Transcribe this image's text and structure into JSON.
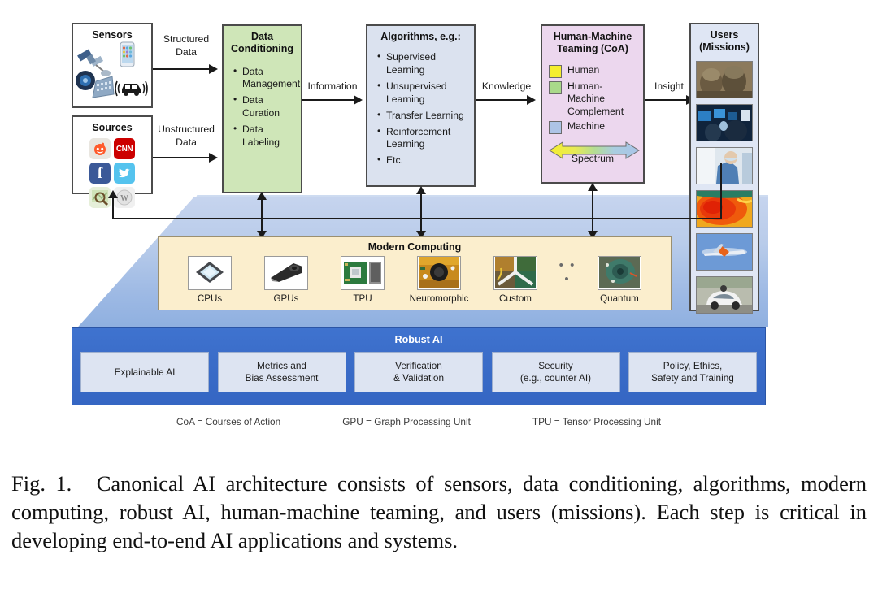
{
  "figure": {
    "sensors": {
      "title": "Sensors",
      "icons": [
        "satellite-icon",
        "smartphone-icon",
        "radar-icon",
        "building-sensor-icon",
        "connected-car-icon"
      ]
    },
    "sources": {
      "title": "Sources",
      "icons": [
        "reddit-icon",
        "cnn-icon",
        "facebook-icon",
        "twitter-icon",
        "google-maps-icon",
        "wikipedia-icon"
      ]
    },
    "arrows": {
      "structured": "Structured\nData",
      "structured_l1": "Structured",
      "structured_l2": "Data",
      "unstructured_l1": "Unstructured",
      "unstructured_l2": "Data",
      "information": "Information",
      "knowledge": "Knowledge",
      "insight": "Insight"
    },
    "data_conditioning": {
      "title_l1": "Data",
      "title_l2": "Conditioning",
      "items": [
        "Data Management",
        "Data Curation",
        "Data Labeling"
      ]
    },
    "algorithms": {
      "title": "Algorithms, e.g.:",
      "items": [
        "Supervised Learning",
        "Unsupervised Learning",
        "Transfer Learning",
        "Reinforcement Learning",
        "Etc."
      ]
    },
    "hmt": {
      "title_l1": "Human-Machine",
      "title_l2": "Teaming (CoA)",
      "legend": [
        {
          "label": "Human",
          "color": "#f5ee2e"
        },
        {
          "label": "Human-Machine Complement",
          "color": "#a9d98a"
        },
        {
          "label": "Machine",
          "color": "#adc4e6"
        }
      ],
      "spectrum_label": "Spectrum"
    },
    "users": {
      "title_l1": "Users",
      "title_l2": "(Missions)",
      "thumbnails": [
        "soldiers-photo",
        "operations-center-photo",
        "medical-staff-photo",
        "thermal-map-photo",
        "aircraft-photo",
        "autonomous-car-photo"
      ]
    },
    "modern_computing": {
      "title": "Modern Computing",
      "items": [
        {
          "label": "CPUs",
          "icon": "cpu-chip-icon"
        },
        {
          "label": "GPUs",
          "icon": "gpu-card-icon"
        },
        {
          "label": "TPU",
          "icon": "tpu-board-icon"
        },
        {
          "label": "Neuromorphic",
          "icon": "neuromorphic-chip-icon"
        },
        {
          "label": "Custom",
          "icon": "custom-hardware-icon"
        },
        {
          "label": "Quantum",
          "icon": "quantum-processor-icon"
        }
      ],
      "ellipsis": "• • •"
    },
    "robust_ai": {
      "title": "Robust AI",
      "cards": [
        "Explainable AI",
        "Metrics and\nBias Assessment",
        "Verification\n& Validation",
        "Security\n(e.g., counter AI)",
        "Policy, Ethics,\nSafety and Training"
      ],
      "cards_lines": [
        [
          "Explainable AI"
        ],
        [
          "Metrics and",
          "Bias Assessment"
        ],
        [
          "Verification",
          "& Validation"
        ],
        [
          "Security",
          "(e.g., counter AI)"
        ],
        [
          "Policy, Ethics,",
          "Safety and Training"
        ]
      ]
    },
    "acronyms": [
      "CoA = Courses of Action",
      "GPU = Graph Processing Unit",
      "TPU = Tensor Processing Unit"
    ]
  },
  "caption": {
    "label": "Fig. 1.",
    "text": "Canonical AI architecture consists of sensors, data conditioning, algorithms, modern computing, robust AI, human-machine teaming, and users (missions). Each step is critical in developing end-to-end AI applications and systems."
  },
  "colors": {
    "data_conditioning": "#cfe6b8",
    "algorithms": "#dbe2ef",
    "hmt": "#ecd7ee",
    "users": "#dfe6f4",
    "modern_computing": "#fbeecd",
    "robust_ai": "#3a6cc8"
  }
}
